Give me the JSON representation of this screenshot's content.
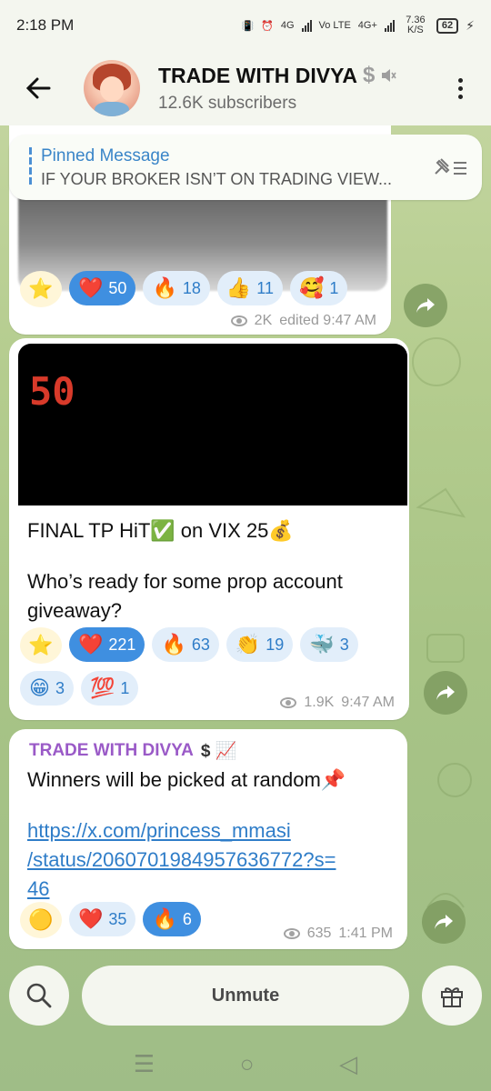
{
  "status_bar": {
    "time": "2:18 PM",
    "net1": "4G",
    "net2": "Vo LTE",
    "net3": "4G+",
    "speed": "7.36 K/S",
    "battery": "62"
  },
  "header": {
    "title": "TRADE WITH DIVYA",
    "title_emoji": "$",
    "subscribers": "12.6K subscribers"
  },
  "pinned": {
    "title": "Pinned Message",
    "text": "IF YOUR BROKER ISN’T ON TRADING VIEW..."
  },
  "messages": [
    {
      "reactions": [
        {
          "emoji": "⭐",
          "count": ""
        },
        {
          "emoji": "❤️",
          "count": "50",
          "selected": true
        },
        {
          "emoji": "🔥",
          "count": "18"
        },
        {
          "emoji": "👍",
          "count": "11"
        },
        {
          "emoji": "🥰",
          "count": "1"
        }
      ],
      "views": "2K",
      "time": "edited 9:47 AM"
    },
    {
      "image_number": "50",
      "line1": "FINAL TP HiT✅ on VIX 25💰",
      "line2": "Who’s ready for some prop account giveaway?",
      "reactions": [
        {
          "emoji": "⭐",
          "count": ""
        },
        {
          "emoji": "❤️",
          "count": "221",
          "selected": true
        },
        {
          "emoji": "🔥",
          "count": "63"
        },
        {
          "emoji": "👏",
          "count": "19"
        },
        {
          "emoji": "🐳",
          "count": "3"
        },
        {
          "emoji": "😁",
          "count": "3"
        },
        {
          "emoji": "💯",
          "count": "1"
        }
      ],
      "views": "1.9K",
      "time": "9:47 AM"
    },
    {
      "sender": "TRADE WITH DIVYA",
      "sender_emoji": "$ 📈",
      "text": "Winners will be picked at random📌",
      "link": "https://x.com/princess_mmasi/status/2060701984957636772?s=46",
      "link_line1": "https://x.com/princess_mmasi",
      "link_line2": "/status/2060701984957636772?s=",
      "link_line3": "46",
      "reactions": [
        {
          "emoji": "🟡",
          "count": ""
        },
        {
          "emoji": "❤️",
          "count": "35"
        },
        {
          "emoji": "🔥",
          "count": "6",
          "selected": true
        }
      ],
      "views": "635",
      "time": "1:41 PM"
    }
  ],
  "bottom": {
    "unmute_label": "Unmute"
  },
  "icons": {
    "back": "back-arrow-icon",
    "menu": "more-vertical-icon",
    "unpin": "unpin-icon",
    "forward": "share-forward-icon",
    "search": "search-icon",
    "gift": "gift-icon"
  }
}
